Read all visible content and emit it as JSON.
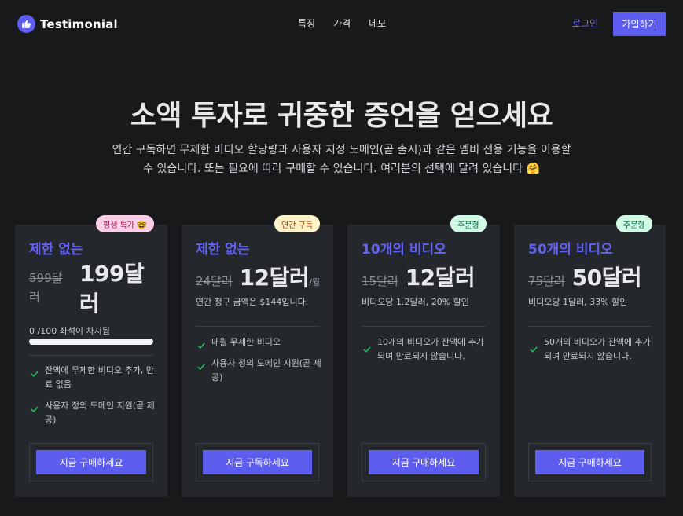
{
  "nav": {
    "brand": "Testimonial",
    "links": [
      "특징",
      "가격",
      "데모"
    ],
    "login": "로그인",
    "signup": "가입하기"
  },
  "hero": {
    "title": "소액 투자로 귀중한 증언을 얻으세요",
    "subtitle_line1": "연간 구독하면 무제한 비디오 할당량과 사용자 지정 도메인(곧 출시)과 같은 멤버 전용 기능을 이용할",
    "subtitle_line2": "수 있습니다. 또는 필요에 따라 구매할 수 있습니다. 여러분의 선택에 달려 있습니다 🤗"
  },
  "plans": [
    {
      "badge": "평생 특가 🤓",
      "title": "제한 없는",
      "old_price": "599달",
      "old_price_cont": "러",
      "new_price": "199달",
      "new_price_cont": "러",
      "seats_label": "0 /100 좌석이 차지됨",
      "seats_filled": 0,
      "seats_total": 100,
      "features": [
        "잔액에 무제한 비디오 추가, 만료 없음",
        "사용자 정의 도메인 지원(곧 제공)"
      ],
      "button": "지금 구매하세요"
    },
    {
      "badge": "연간 구독",
      "title": "제한 없는",
      "old_price": "24달러",
      "new_price": "12달러",
      "per": "/월",
      "note": "연간 청구 금액은 $144입니다.",
      "features": [
        "매월 무제한 비디오",
        "사용자 정의 도메인 지원(곧 제공)"
      ],
      "button": "지금 구독하세요"
    },
    {
      "badge": "주문형",
      "title": "10개의 비디오",
      "old_price": "15달러",
      "new_price": "12달러",
      "note": "비디오당 1.2달러, 20% 할인",
      "features": [
        "10개의 비디오가 잔액에 추가되며 만료되지 않습니다."
      ],
      "button": "지금 구매하세요"
    },
    {
      "badge": "주문형",
      "title": "50개의 비디오",
      "old_price": "75달러",
      "new_price": "50달러",
      "note": "비디오당 1달러, 33% 할인",
      "features": [
        "50개의 비디오가 잔액에 추가되며 만료되지 않습니다."
      ],
      "button": "지금 구매하세요"
    }
  ],
  "colors": {
    "accent": "#5d5df0",
    "background": "#17191b",
    "card": "#24272c",
    "check": "#22c55e",
    "badge_lifetime_bg": "#fbcfe8",
    "badge_lifetime_fg": "#9d174d",
    "badge_annual_bg": "#fef3c7",
    "badge_annual_fg": "#92400e",
    "badge_ondemand_bg": "#d1fae5",
    "badge_ondemand_fg": "#065f46"
  }
}
